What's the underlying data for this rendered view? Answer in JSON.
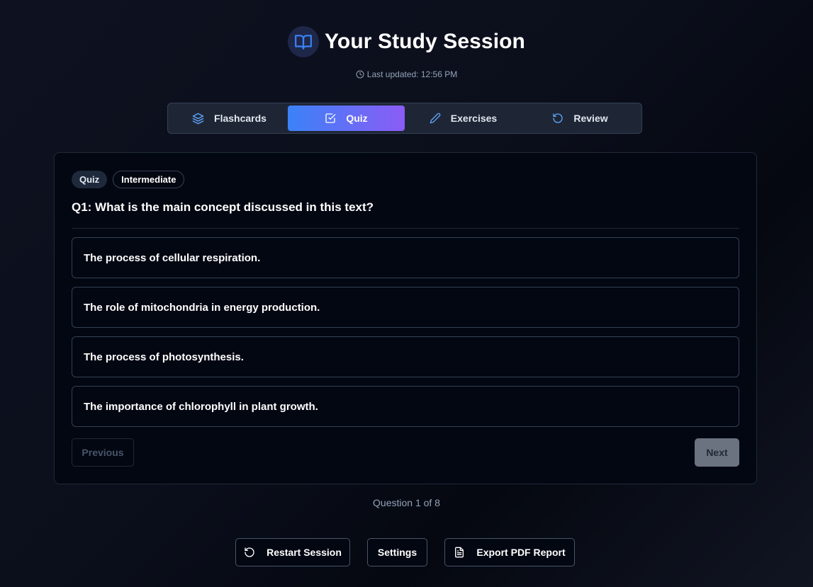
{
  "header": {
    "title": "Your Study Session",
    "last_updated": "Last updated: 12:56 PM",
    "logo_icon": "open-book-icon"
  },
  "tabs": [
    {
      "label": "Flashcards",
      "icon": "layers-icon",
      "active": false
    },
    {
      "label": "Quiz",
      "icon": "checkbox-icon",
      "active": true
    },
    {
      "label": "Exercises",
      "icon": "pencil-icon",
      "active": false
    },
    {
      "label": "Review",
      "icon": "rotate-icon",
      "active": false
    }
  ],
  "quiz": {
    "badge_type": "Quiz",
    "badge_level": "Intermediate",
    "question": "Q1: What is the main concept discussed in this text?",
    "options": [
      "The process of cellular respiration.",
      "The role of mitochondria in energy production.",
      "The process of photosynthesis.",
      "The importance of chlorophyll in plant growth."
    ],
    "previous_label": "Previous",
    "next_label": "Next"
  },
  "counter": "Question 1 of 8",
  "footer": {
    "restart_label": "Restart Session",
    "settings_label": "Settings",
    "export_label": "Export PDF Report"
  },
  "colors": {
    "accent_start": "#3b82f6",
    "accent_end": "#8b5cf6",
    "background": "#0b0f1c",
    "card_bg": "#030712"
  }
}
